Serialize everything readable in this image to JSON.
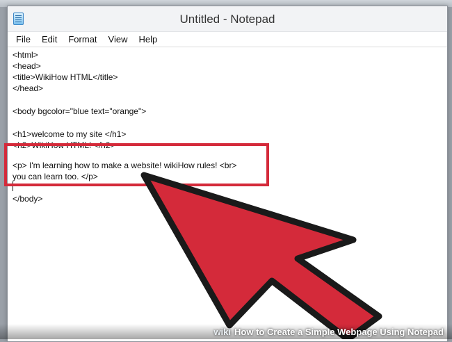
{
  "window": {
    "title": "Untitled - Notepad",
    "icon": "notepad-icon"
  },
  "menubar": {
    "items": [
      "File",
      "Edit",
      "Format",
      "View",
      "Help"
    ]
  },
  "editor": {
    "lines": [
      "<html>",
      "<head>",
      "<title>WikiHow HTML</title>",
      "</head>",
      "",
      "<body bgcolor=\"blue text=\"orange\">",
      "",
      "<h1>welcome to my site </h1>",
      "<h2>WikiHow HTML! </h2>",
      "",
      "<p> I'm learning how to make a website! wikiHow rules! <br>",
      "you can learn too. </p>",
      "",
      "</body>"
    ]
  },
  "annotations": {
    "highlight_color": "#d42a3a",
    "arrow_color": "#d42a3a",
    "arrow_icon": "pointer-arrow-icon"
  },
  "footer": {
    "brand": "wiki",
    "caption": "How to Create a Simple Webpage Using Notepad"
  }
}
